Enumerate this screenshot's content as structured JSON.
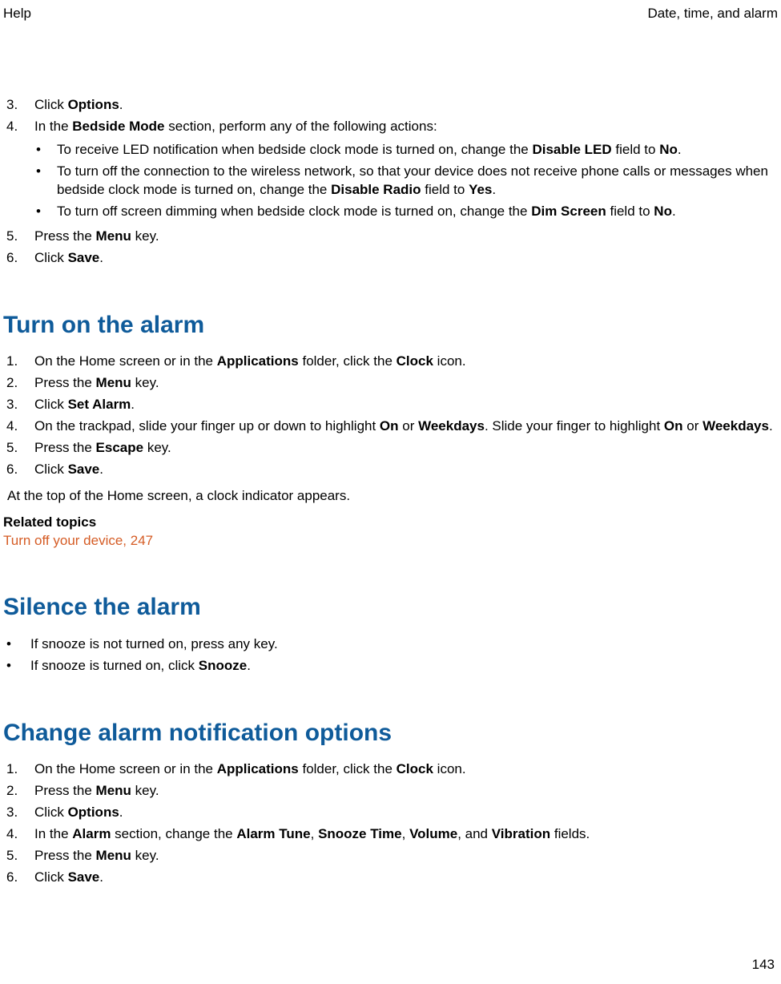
{
  "header": {
    "left": "Help",
    "right": "Date, time, and alarm"
  },
  "intro": {
    "items": [
      {
        "num": "3.",
        "parts": [
          "Click ",
          "Options",
          "."
        ]
      },
      {
        "num": "4.",
        "parts": [
          "In the ",
          "Bedside Mode",
          " section, perform any of the following actions:"
        ],
        "sub": [
          [
            "To receive LED notification when bedside clock mode is turned on, change the ",
            "Disable LED",
            " field to ",
            "No",
            "."
          ],
          [
            "To turn off the connection to the wireless network, so that your device does not receive phone calls or messages when bedside clock mode is turned on, change the ",
            "Disable Radio",
            " field to ",
            "Yes",
            "."
          ],
          [
            "To turn off screen dimming when bedside clock mode is turned on, change the ",
            "Dim Screen",
            " field to ",
            "No",
            "."
          ]
        ]
      },
      {
        "num": "5.",
        "parts": [
          "Press the ",
          "Menu",
          " key."
        ]
      },
      {
        "num": "6.",
        "parts": [
          "Click ",
          "Save",
          "."
        ]
      }
    ]
  },
  "section1": {
    "heading": "Turn on the alarm",
    "items": [
      {
        "num": "1.",
        "parts": [
          "On the Home screen or in the ",
          "Applications",
          " folder, click the ",
          "Clock",
          " icon."
        ]
      },
      {
        "num": "2.",
        "parts": [
          "Press the ",
          "Menu",
          " key."
        ]
      },
      {
        "num": "3.",
        "parts": [
          "Click ",
          "Set Alarm",
          "."
        ]
      },
      {
        "num": "4.",
        "parts": [
          "On the trackpad, slide your finger up or down to highlight ",
          "On",
          " or ",
          "Weekdays",
          ". Slide your finger to highlight ",
          "On",
          " or ",
          "Weekdays",
          "."
        ]
      },
      {
        "num": "5.",
        "parts": [
          "Press the ",
          "Escape",
          " key."
        ]
      },
      {
        "num": "6.",
        "parts": [
          "Click ",
          "Save",
          "."
        ]
      }
    ],
    "note": "At the top of the Home screen, a clock indicator appears.",
    "related_title": "Related topics",
    "related_link": "Turn off your device, 247"
  },
  "section2": {
    "heading": "Silence the alarm",
    "bullets": [
      [
        "If snooze is not turned on, press any key."
      ],
      [
        "If snooze is turned on, click ",
        "Snooze",
        "."
      ]
    ]
  },
  "section3": {
    "heading": "Change alarm notification options",
    "items": [
      {
        "num": "1.",
        "parts": [
          "On the Home screen or in the ",
          "Applications",
          " folder, click the ",
          "Clock",
          " icon."
        ]
      },
      {
        "num": "2.",
        "parts": [
          "Press the ",
          "Menu",
          " key."
        ]
      },
      {
        "num": "3.",
        "parts": [
          "Click ",
          "Options",
          "."
        ]
      },
      {
        "num": "4.",
        "parts": [
          "In the ",
          "Alarm",
          " section, change the ",
          "Alarm Tune",
          ", ",
          "Snooze Time",
          ", ",
          "Volume",
          ", and ",
          "Vibration",
          " fields."
        ]
      },
      {
        "num": "5.",
        "parts": [
          "Press the ",
          "Menu",
          " key."
        ]
      },
      {
        "num": "6.",
        "parts": [
          "Click ",
          "Save",
          "."
        ]
      }
    ]
  },
  "page_number": "143"
}
